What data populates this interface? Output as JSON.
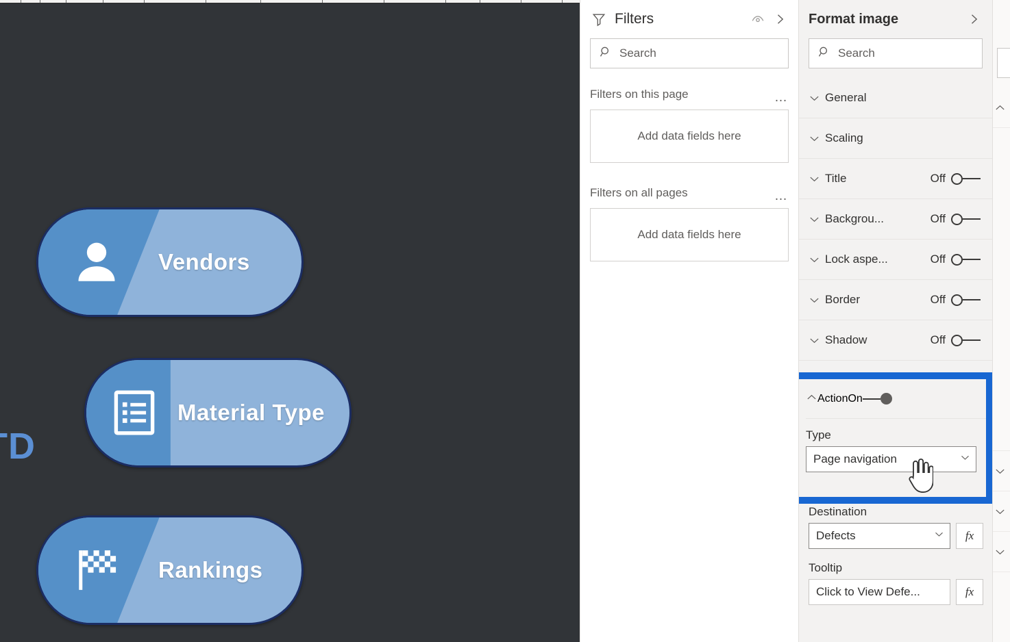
{
  "canvas": {
    "background_color": "#313438",
    "cut_off_text": "TD",
    "nav_buttons": [
      {
        "label": "Vendors",
        "icon": "person-icon",
        "wedge": "diag"
      },
      {
        "label": "Material Type",
        "icon": "list-icon",
        "wedge": "straight"
      },
      {
        "label": "Rankings",
        "icon": "checkered-flag-icon",
        "wedge": "diag"
      }
    ]
  },
  "filters_panel": {
    "title": "Filters",
    "eye_icon": "eye-icon",
    "collapse_icon": "chevron-right-icon",
    "search": {
      "icon": "search-icon",
      "placeholder": "Search"
    },
    "groups": [
      {
        "label": "Filters on this page",
        "menu": "…",
        "dropzone": "Add data fields here"
      },
      {
        "label": "Filters on all pages",
        "menu": "…",
        "dropzone": "Add data fields here"
      }
    ]
  },
  "format_panel": {
    "title": "Format image",
    "collapse_icon": "chevron-right-icon",
    "search": {
      "icon": "search-icon",
      "placeholder": "Search"
    },
    "sections": [
      {
        "name": "General",
        "toggle": null,
        "chevron": "chevron-down-icon"
      },
      {
        "name": "Scaling",
        "toggle": null,
        "chevron": "chevron-down-icon"
      },
      {
        "name": "Title",
        "toggle": "Off",
        "chevron": "chevron-down-icon"
      },
      {
        "name": "Backgrou...",
        "toggle": "Off",
        "chevron": "chevron-down-icon"
      },
      {
        "name": "Lock aspe...",
        "toggle": "Off",
        "chevron": "chevron-down-icon"
      },
      {
        "name": "Border",
        "toggle": "Off",
        "chevron": "chevron-down-icon"
      },
      {
        "name": "Shadow",
        "toggle": "Off",
        "chevron": "chevron-down-icon"
      }
    ],
    "action_section": {
      "name": "Action",
      "toggle": "On",
      "chevron": "chevron-up-icon",
      "highlight_color": "#1867d2",
      "type_label": "Type",
      "type_value": "Page navigation"
    },
    "destination": {
      "label": "Destination",
      "value": "Defects",
      "fx_label": "fx"
    },
    "tooltip": {
      "label": "Tooltip",
      "value": "Click to View Defe...",
      "fx_label": "fx"
    }
  },
  "third_panel": {
    "search_icon": "search-icon",
    "chevrons": [
      "chevron-up-icon",
      "chevron-down-icon",
      "chevron-down-icon",
      "chevron-down-icon"
    ]
  },
  "cursor": {
    "icon": "hand-pointer-cursor"
  }
}
